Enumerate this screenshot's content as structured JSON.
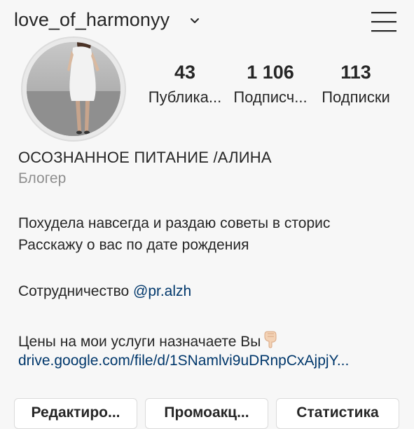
{
  "header": {
    "username": "love_of_harmonyy",
    "chevron_icon": "chevron-down-icon",
    "menu_icon": "hamburger-menu-icon"
  },
  "stats": [
    {
      "value": "43",
      "label": "Публика..."
    },
    {
      "value": "1 106",
      "label": "Подписч..."
    },
    {
      "value": "113",
      "label": "Подписки"
    }
  ],
  "profile": {
    "name": "ОСОЗНАННОЕ ПИТАНИЕ /АЛИНА",
    "category": "Блогер",
    "bio_line1": "Похудела навсегда и раздаю советы в сторис",
    "bio_line2": "Расскажу о вас по дате рождения",
    "collab_text": "Сотрудничество ",
    "collab_mention": "@pr.alzh",
    "prices_text": "Цены на мои услуги назначаете Вы",
    "prices_emoji": "pointing-down-hand-icon",
    "link": "drive.google.com/file/d/1SNamlvi9uDRnpCxAjpjY..."
  },
  "buttons": [
    {
      "label": "Редактиро..."
    },
    {
      "label": "Промоакц..."
    },
    {
      "label": "Статистика"
    }
  ]
}
